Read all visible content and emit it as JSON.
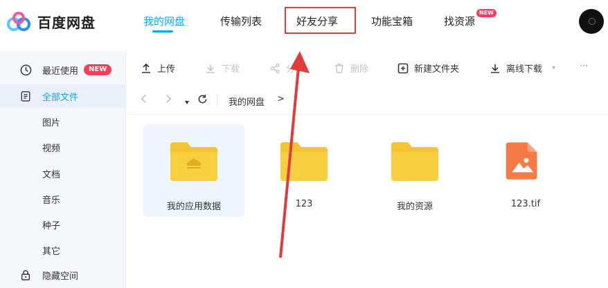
{
  "app": {
    "name": "百度网盘"
  },
  "nav": {
    "items": [
      {
        "label": "我的网盘",
        "active": true
      },
      {
        "label": "传输列表",
        "active": false
      },
      {
        "label": "好友分享",
        "active": false,
        "highlighted": true
      },
      {
        "label": "功能宝箱",
        "active": false
      },
      {
        "label": "找资源",
        "active": false,
        "badge": "NEW"
      }
    ]
  },
  "sidebar": {
    "items": [
      {
        "label": "最近使用",
        "icon": "clock-icon",
        "badge": "NEW"
      },
      {
        "label": "全部文件",
        "icon": "document-icon",
        "active": true
      },
      {
        "label": "图片"
      },
      {
        "label": "视频"
      },
      {
        "label": "文档"
      },
      {
        "label": "音乐"
      },
      {
        "label": "种子"
      },
      {
        "label": "其它"
      },
      {
        "label": "隐藏空间",
        "icon": "lock-icon"
      }
    ]
  },
  "toolbar": {
    "upload": "上传",
    "download": "下载",
    "share": "分享",
    "delete": "删除",
    "new_folder": "新建文件夹",
    "offline_download": "离线下载",
    "more": "···"
  },
  "breadcrumb": {
    "path": "我的网盘",
    "separator": ">"
  },
  "files": [
    {
      "name": "我的应用数据",
      "type": "folder-app",
      "selected": true
    },
    {
      "name": "123",
      "type": "folder"
    },
    {
      "name": "我的资源",
      "type": "folder"
    },
    {
      "name": "123.tif",
      "type": "image-file"
    }
  ],
  "colors": {
    "accent": "#06a7ff",
    "badge": "#fa3c5b",
    "folder": "#f5c531",
    "image_file": "#f47a46",
    "highlight_box": "#e23b3b"
  }
}
